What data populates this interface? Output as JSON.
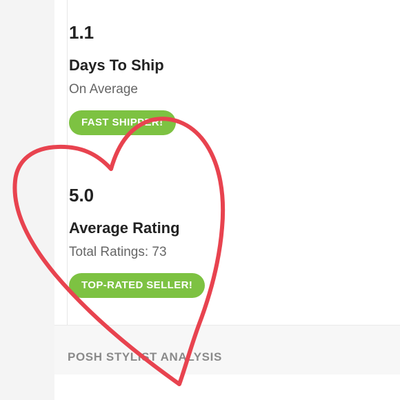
{
  "shipping": {
    "value": "1.1",
    "label": "Days To Ship",
    "sub": "On Average",
    "badge": "FAST SHIPPER!"
  },
  "rating": {
    "value": "5.0",
    "label": "Average Rating",
    "sub": "Total Ratings: 73",
    "badge": "TOP-RATED SELLER!"
  },
  "section": {
    "title": "POSH STYLIST ANALYSIS"
  },
  "colors": {
    "badge_green": "#7dc242",
    "heart_red": "#e8434f"
  },
  "icons": {
    "annotation": "hand-drawn-heart-icon"
  }
}
